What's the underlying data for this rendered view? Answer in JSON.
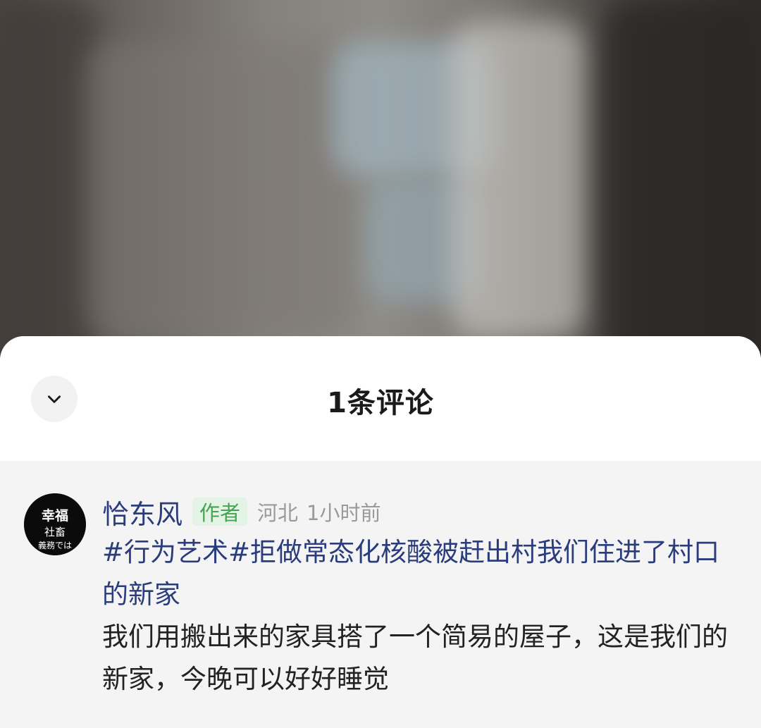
{
  "sheet": {
    "title": "1条评论",
    "collapse_icon": "chevron-down-icon"
  },
  "comment": {
    "username": "恰东风",
    "badge": "作者",
    "location": "河北",
    "time": "1小时前",
    "avatar_icon": "avatar-icon",
    "avatar_text": "幸福は社畜義務では",
    "hashtags": "#行为艺术#拒做常态化核酸被赶出村我们住进了村口的新家",
    "text": "我们用搬出来的家具搭了一个简易的屋子，这是我们的新家，今晚可以好好睡觉"
  },
  "colors": {
    "username": "#2a3c7c",
    "badge_bg": "#e3f3e5",
    "badge_text": "#46a352",
    "sheet_bg": "#ffffff",
    "comment_bg": "#f4f4f4"
  }
}
